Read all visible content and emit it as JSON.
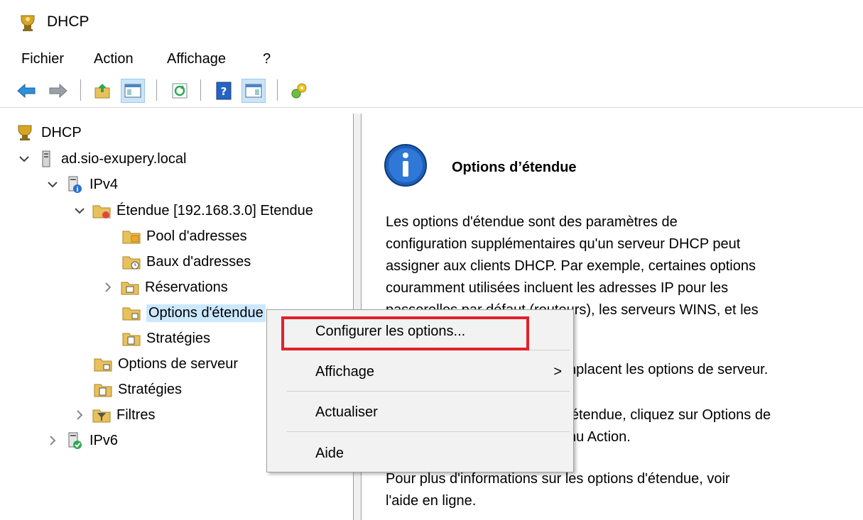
{
  "window": {
    "title": "DHCP"
  },
  "menubar": {
    "items": [
      "Fichier",
      "Action",
      "Affichage",
      "?"
    ]
  },
  "toolbar": {
    "buttons": [
      "back-icon",
      "forward-icon",
      "up-folder-icon",
      "console-tree-icon",
      "refresh-icon",
      "help-icon",
      "action-pane-icon",
      "extra-icon"
    ]
  },
  "tree": {
    "root": "DHCP",
    "server": "ad.sio-exupery.local",
    "ipv4": "IPv4",
    "scope": "Étendue [192.168.3.0] Etendue",
    "pool": "Pool d'adresses",
    "leases": "Baux d'adresses",
    "reservations": "Réservations",
    "scope_options": "Options d'étendue",
    "scope_policies": "Stratégies",
    "server_options": "Options de serveur",
    "policies": "Stratégies",
    "filters": "Filtres",
    "ipv6": "IPv6"
  },
  "content": {
    "title": "Options d’étendue",
    "para1": [
      "Les options d'étendue sont des paramètres de",
      "configuration supplémentaires qu'un serveur DHCP peut",
      "assigner aux clients DHCP. Par exemple, certaines options",
      "couramment utilisées incluent les adresses IP pour les",
      "passerelles par défaut (routeurs), les serveurs WINS, et les"
    ],
    "para2": "nplacent les options de serveur.",
    "para3": [
      "'étendue, cliquez sur Options de",
      "nu Action."
    ],
    "para4": [
      "Pour plus d'informations sur les options d'étendue, voir",
      "l'aide en ligne."
    ]
  },
  "context_menu": {
    "configure": "Configurer les options...",
    "view": "Affichage",
    "view_arrow": ">",
    "refresh": "Actualiser",
    "help": "Aide"
  },
  "colors": {
    "highlight": "#e3202a",
    "selection": "#cce8ff",
    "info_blue": "#1f5fb8"
  }
}
